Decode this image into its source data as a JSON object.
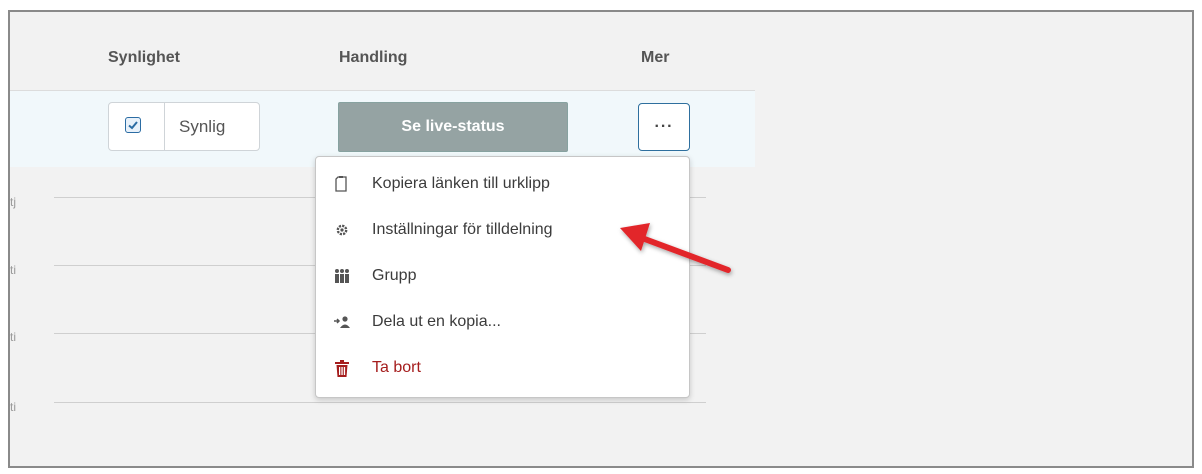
{
  "header": {
    "col_visibility": "Synlighet",
    "col_action": "Handling",
    "col_more": "Mer"
  },
  "row": {
    "visibility_label": "Synlig",
    "visibility_checked": true,
    "live_status_button": "Se live-status",
    "more_button": "···"
  },
  "row_stubs": [
    "tj",
    "ti",
    "ti",
    "ti"
  ],
  "menu": {
    "items": [
      {
        "label": "Kopiera länken till urklipp",
        "icon": "clipboard-icon"
      },
      {
        "label": "Inställningar för tilldelning",
        "icon": "gear-icon"
      },
      {
        "label": "Grupp",
        "icon": "group-icon"
      },
      {
        "label": "Dela ut en kopia...",
        "icon": "share-copy-icon"
      },
      {
        "label": "Ta bort",
        "icon": "trash-icon",
        "danger": true
      }
    ]
  },
  "colors": {
    "accent_blue": "#2e6f9e",
    "button_gray": "#95a3a3",
    "danger_red": "#a51d1d",
    "annotation_arrow": "#e2252c"
  }
}
